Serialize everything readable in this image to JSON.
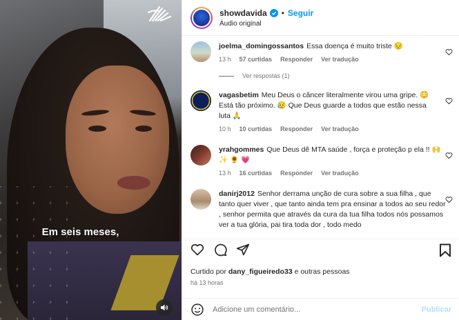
{
  "video": {
    "caption": "Em seis meses,"
  },
  "header": {
    "username": "showdavida",
    "separator": "•",
    "follow_label": "Seguir",
    "audio_label": "Áudio original"
  },
  "comments": [
    {
      "username": "joelma_domingossantos",
      "text": "Essa doença é muito triste 😔",
      "time": "13 h",
      "likes": "57 curtidas",
      "reply_label": "Responder",
      "translate_label": "Ver tradução",
      "replies_label": "Ver respostas (1)"
    },
    {
      "username": "vagasbetim",
      "text": "Meu Deus o câncer literalmente virou uma gripe. 😳 Está tão próximo. 😥 Que Deus guarde a todos que estão nessa luta 🙏",
      "time": "10 h",
      "likes": "10 curtidas",
      "reply_label": "Responder",
      "translate_label": "Ver tradução"
    },
    {
      "username": "yrahgommes",
      "text": "Que Deus dê MTA saúde , força e proteção p ela !! 🙌 ✨ 🌻 💗",
      "time": "13 h",
      "likes": "16 curtidas",
      "reply_label": "Responder",
      "translate_label": "Ver tradução"
    },
    {
      "username": "danirj2012",
      "text": "Senhor derrama unção de cura sobre a sua filha , que tanto quer viver , que tanto ainda tem pra ensinar a todos ao seu redor , senhor permita que através da cura da tua filha todos nós possamos ver a tua glória, pai tira toda dor , todo medo"
    }
  ],
  "footer": {
    "liked_prefix": "Curtido por",
    "liked_user": "dany_figueiredo33",
    "liked_suffix": "e outras pessoas",
    "time_ago": "há 13 horas",
    "add_comment_placeholder": "Adicione um comentário...",
    "publish_label": "Publicar"
  },
  "colors": {
    "accent": "#0095f6",
    "muted": "#737373",
    "text": "#262626"
  }
}
